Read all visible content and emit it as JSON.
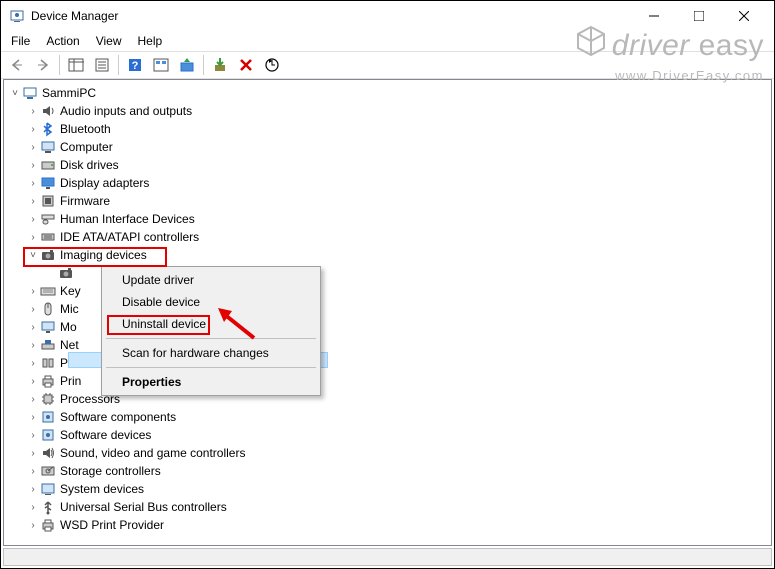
{
  "window": {
    "title": "Device Manager"
  },
  "menus": {
    "file": "File",
    "action": "Action",
    "view": "View",
    "help": "Help"
  },
  "root": {
    "name": "SammiPC"
  },
  "categories": [
    "Audio inputs and outputs",
    "Bluetooth",
    "Computer",
    "Disk drives",
    "Display adapters",
    "Firmware",
    "Human Interface Devices",
    "IDE ATA/ATAPI controllers",
    "Imaging devices",
    "Key",
    "Mic",
    "Mo",
    "Net",
    "Por",
    "Prin",
    "Processors",
    "Software components",
    "Software devices",
    "Sound, video and game controllers",
    "Storage controllers",
    "System devices",
    "Universal Serial Bus controllers",
    "WSD Print Provider"
  ],
  "context_menu": {
    "update": "Update driver",
    "disable": "Disable device",
    "uninstall": "Uninstall device",
    "scan": "Scan for hardware changes",
    "properties": "Properties"
  },
  "watermark": {
    "brand_prefix": "driver",
    "brand_suffix": " easy",
    "url": "www.DriverEasy.com"
  }
}
